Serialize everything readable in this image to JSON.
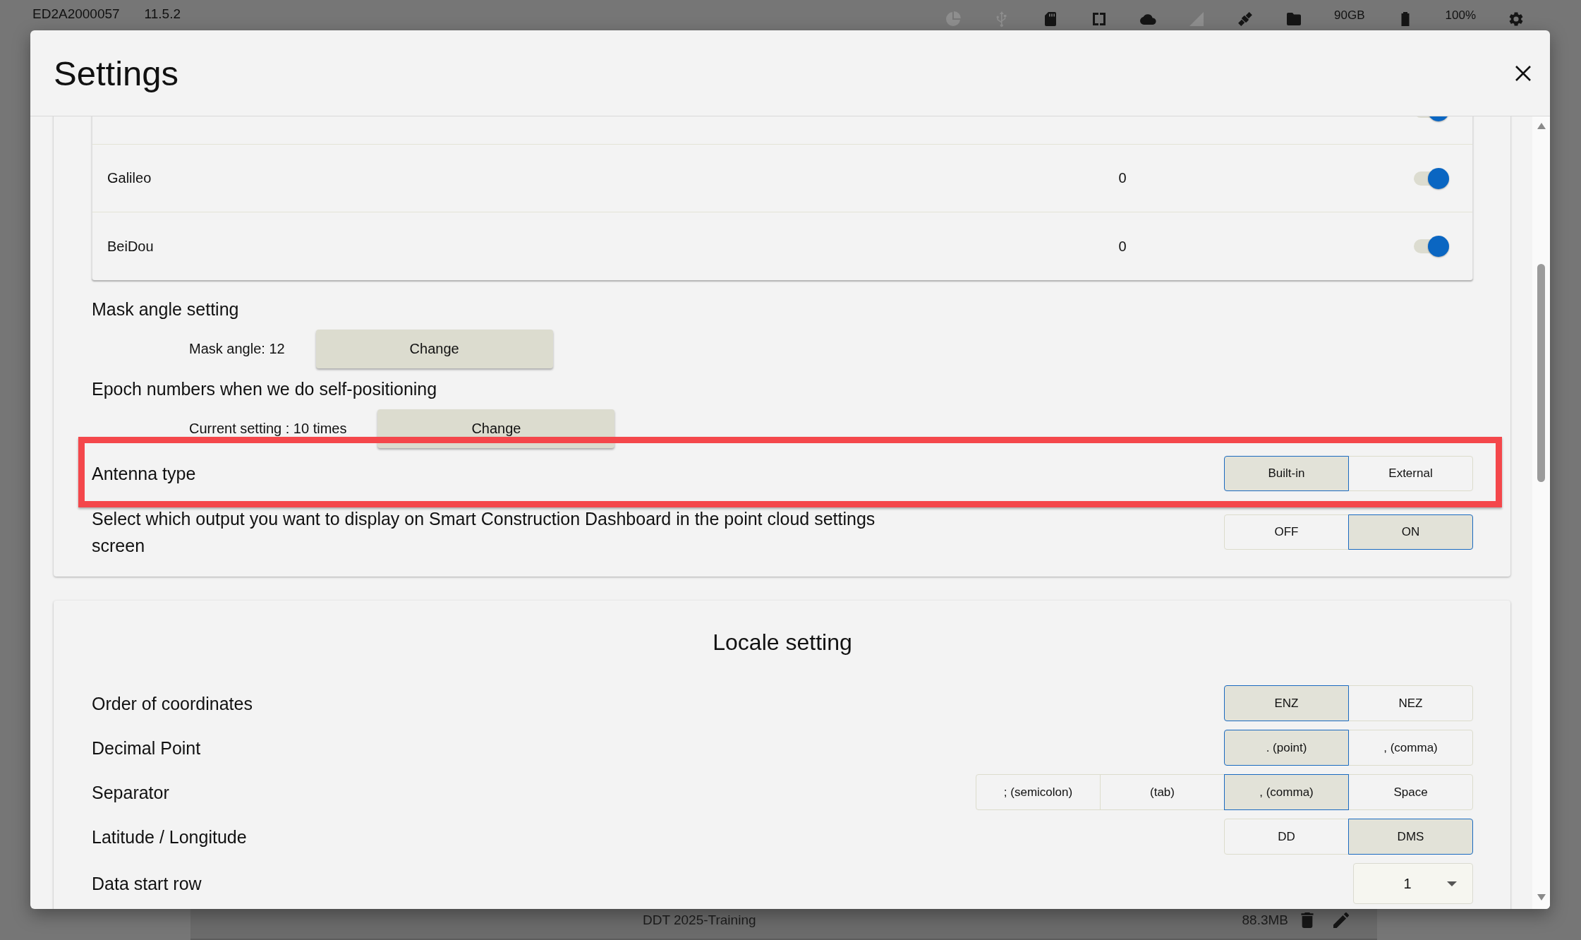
{
  "status_bar": {
    "device_id": "ED2A2000057",
    "version": "11.5.2",
    "indicators": [
      {
        "active": false
      },
      {
        "active": false
      },
      {
        "active": true
      },
      {
        "active": true
      },
      {
        "active": true
      },
      {
        "active": false
      },
      {
        "active": true
      },
      {
        "active": true
      }
    ],
    "storage": "90GB",
    "battery": "100%"
  },
  "background_list": {
    "file_name": "DDT 2025-Training",
    "file_size": "88.3MB"
  },
  "dialog": {
    "title": "Settings",
    "gnss_rows": [
      {
        "on": true
      },
      {
        "name": "Galileo",
        "value": "0",
        "on": true
      },
      {
        "name": "BeiDou",
        "value": "0",
        "on": true
      }
    ],
    "receiver_settings": [
      {
        "kind": "action",
        "heading": "Mask angle setting",
        "reading": "Mask angle: 12",
        "button": "Change"
      },
      {
        "kind": "action",
        "heading": "Epoch numbers when we do self-positioning",
        "reading": "Current setting : 10 times",
        "button": "Change"
      },
      {
        "kind": "choice",
        "label": "Antenna type",
        "highlighted": true,
        "options": [
          {
            "label": "Built-in",
            "selected": true
          },
          {
            "label": "External",
            "selected": false
          }
        ]
      },
      {
        "kind": "choice",
        "label": "Select which output you want to display on Smart Construction Dashboard in the point cloud settings screen",
        "highlighted": false,
        "options": [
          {
            "label": "OFF",
            "selected": false
          },
          {
            "label": "ON",
            "selected": true
          }
        ]
      }
    ],
    "locale": {
      "title": "Locale setting",
      "rows": [
        {
          "kind": "choice",
          "label": "Order of coordinates",
          "options": [
            {
              "label": "ENZ",
              "selected": true
            },
            {
              "label": "NEZ",
              "selected": false
            }
          ]
        },
        {
          "kind": "choice",
          "label": "Decimal Point",
          "options": [
            {
              "label": ". (point)",
              "selected": true
            },
            {
              "label": ", (comma)",
              "selected": false
            }
          ]
        },
        {
          "kind": "choice",
          "label": "Separator",
          "options": [
            {
              "label": "; (semicolon)",
              "selected": false
            },
            {
              "label": "(tab)",
              "selected": false
            },
            {
              "label": ", (comma)",
              "selected": true
            },
            {
              "label": "Space",
              "selected": false
            }
          ]
        },
        {
          "kind": "choice",
          "label": "Latitude / Longitude",
          "options": [
            {
              "label": "DD",
              "selected": false
            },
            {
              "label": "DMS",
              "selected": true
            }
          ]
        },
        {
          "kind": "dropdown",
          "label": "Data start row",
          "value": "1"
        }
      ]
    }
  }
}
